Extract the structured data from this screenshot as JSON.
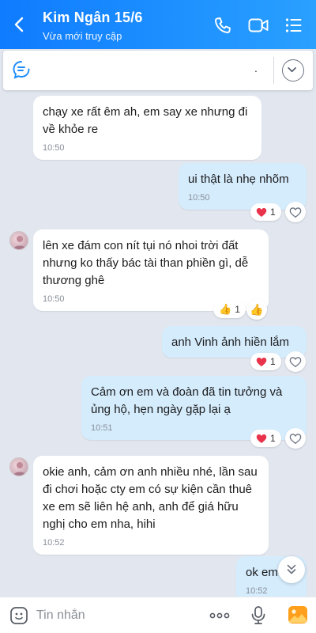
{
  "header": {
    "title": "Kim Ngân 15/6",
    "subtitle": "Vừa mới truy cập"
  },
  "pinned": {
    "text": "."
  },
  "messages": [
    {
      "text": "chạy xe rất êm ah, em say xe nhưng đi về khỏe re",
      "time": "10:50"
    },
    {
      "text": "ui thật là nhẹ nhõm",
      "time": "10:50",
      "reaction_count": "1"
    },
    {
      "text": "lên xe đám con nít tụi nó nhoi trời đất nhưng ko thấy bác tài than phiền gì, dễ thương ghê",
      "time": "10:50",
      "reaction_count": "1"
    },
    {
      "text": "anh Vinh ảnh hiền lắm",
      "reaction_count": "1"
    },
    {
      "text": "Cảm ơn em và đoàn đã tin tưởng và ủng hộ, hẹn ngày gặp lại ạ",
      "time": "10:51",
      "reaction_count": "1"
    },
    {
      "text": "okie anh, cảm ơn anh nhiều nhé, lần sau đi chơi hoặc cty em có sự kiện cần thuê xe em sẽ liên hệ anh, anh để giá hữu nghị cho em nha, hihi",
      "time": "10:52"
    },
    {
      "text": "ok em",
      "time": "10:52"
    }
  ],
  "input": {
    "placeholder": "Tin nhắn"
  },
  "colors": {
    "header": "#1a8cff",
    "outgoing": "#d5ecfd",
    "incoming": "#ffffff",
    "background": "#e1e6ef",
    "heart": "#e8334a"
  }
}
